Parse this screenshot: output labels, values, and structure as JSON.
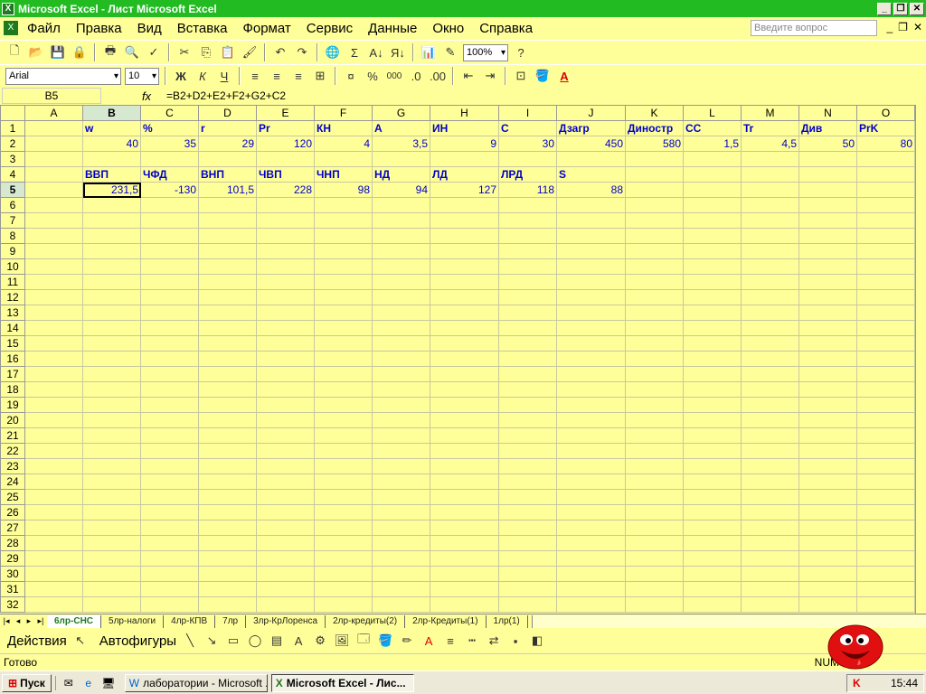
{
  "window": {
    "title": "Microsoft Excel - Лист Microsoft Excel",
    "buttons": [
      "_",
      "❐",
      "✕"
    ]
  },
  "menu": {
    "items": [
      "Файл",
      "Правка",
      "Вид",
      "Вставка",
      "Формат",
      "Сервис",
      "Данные",
      "Окно",
      "Справка"
    ],
    "help_placeholder": "Введите вопрос"
  },
  "toolbar": {
    "zoom": "100%",
    "font_name": "Arial",
    "font_size": "10",
    "bold": "Ж",
    "italic": "К",
    "underline": "Ч",
    "percent": "%",
    "thousands": "000"
  },
  "formula_bar": {
    "name_box": "B5",
    "fx": "fx",
    "formula": "=B2+D2+E2+F2+G2+C2"
  },
  "sheet": {
    "columns": [
      "A",
      "B",
      "C",
      "D",
      "E",
      "F",
      "G",
      "H",
      "I",
      "J",
      "K",
      "L",
      "M",
      "N",
      "O"
    ],
    "row1": [
      "",
      "w",
      "%",
      "r",
      "Pr",
      "КН",
      "А",
      "ИН",
      "С",
      "Дзагр",
      "Диностр",
      "СС",
      "Tr",
      "Див",
      "PrK"
    ],
    "row2": [
      "",
      "40",
      "35",
      "29",
      "120",
      "4",
      "3,5",
      "9",
      "30",
      "450",
      "580",
      "1,5",
      "4,5",
      "50",
      "80"
    ],
    "row4": [
      "",
      "ВВП",
      "ЧФД",
      "ВНП",
      "ЧВП",
      "ЧНП",
      "НД",
      "ЛД",
      "ЛРД",
      "S",
      "",
      "",
      "",
      "",
      ""
    ],
    "row5": [
      "",
      "231,5",
      "-130",
      "101,5",
      "228",
      "98",
      "94",
      "127",
      "118",
      "88",
      "",
      "",
      "",
      "",
      ""
    ],
    "row_count": 32
  },
  "tabs": {
    "items": [
      "6лр-СНС",
      "5лр-налоги",
      "4лр-КПВ",
      "7лр",
      "3лр-КрЛоренса",
      "2лр-кредиты(2)",
      "2лр-Кредиты(1)",
      "1лр(1)"
    ],
    "active": 0
  },
  "drawing": {
    "actions_label": "Действия",
    "autoshapes_label": "Автофигуры"
  },
  "status": {
    "ready": "Готово",
    "num": "NUM"
  },
  "taskbar": {
    "start": "Пуск",
    "windows": [
      "лаборатории - Microsoft ...",
      "Microsoft Excel - Лис..."
    ],
    "clock": "15:44"
  }
}
